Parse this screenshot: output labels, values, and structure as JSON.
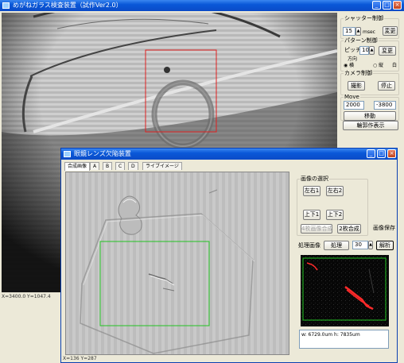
{
  "main_window": {
    "title": "めがねガラス検査装置（試作Ver2.0）",
    "shutter": {
      "group_label": "シャッター制御",
      "value": "15",
      "unit": "msec",
      "change_label": "変更"
    },
    "pattern": {
      "group_label": "パターン制御",
      "pitch_label": "ピッチ",
      "pitch_value": "10",
      "change_label": "変更",
      "direction_label": "方向",
      "horizontal_label": "横",
      "vertical_label": "縦",
      "white_label": "白"
    },
    "camera": {
      "group_label": "カメラ制御",
      "capture_label": "撮影",
      "stop_label": "停止"
    },
    "move": {
      "group_label": "Move",
      "x_value": "2000",
      "y_value": "-3800",
      "move_label": "移動"
    },
    "contour_label": "輪郭作表示",
    "status_text": "X=3400.0 Y=1047.4"
  },
  "sub_window": {
    "title": "眼鏡レンズ欠陥装置",
    "tabs": [
      "合成画像",
      "A",
      "B",
      "C",
      "D",
      "ライブイメージ"
    ],
    "select_group_label": "画像の選択",
    "left_right_1": "左右1",
    "left_right_2": "左右2",
    "up_down_1": "上下1",
    "up_down_2": "上下2",
    "combine4_label": "4枚画像合成",
    "combine2_label": "2枚合成",
    "save_label": "画像保存",
    "process_label": "処理画像",
    "process_button": "処理",
    "process_value": "30",
    "analyze_button": "解析",
    "result_text": "w: 6729.0um    h: 7835um",
    "status_text": "X=136 Y=287"
  },
  "colors": {
    "titlebar": "#0a58d8",
    "roi_main": "#e02020",
    "roi_sub": "#22c422",
    "defect": "#ff2a2a"
  }
}
